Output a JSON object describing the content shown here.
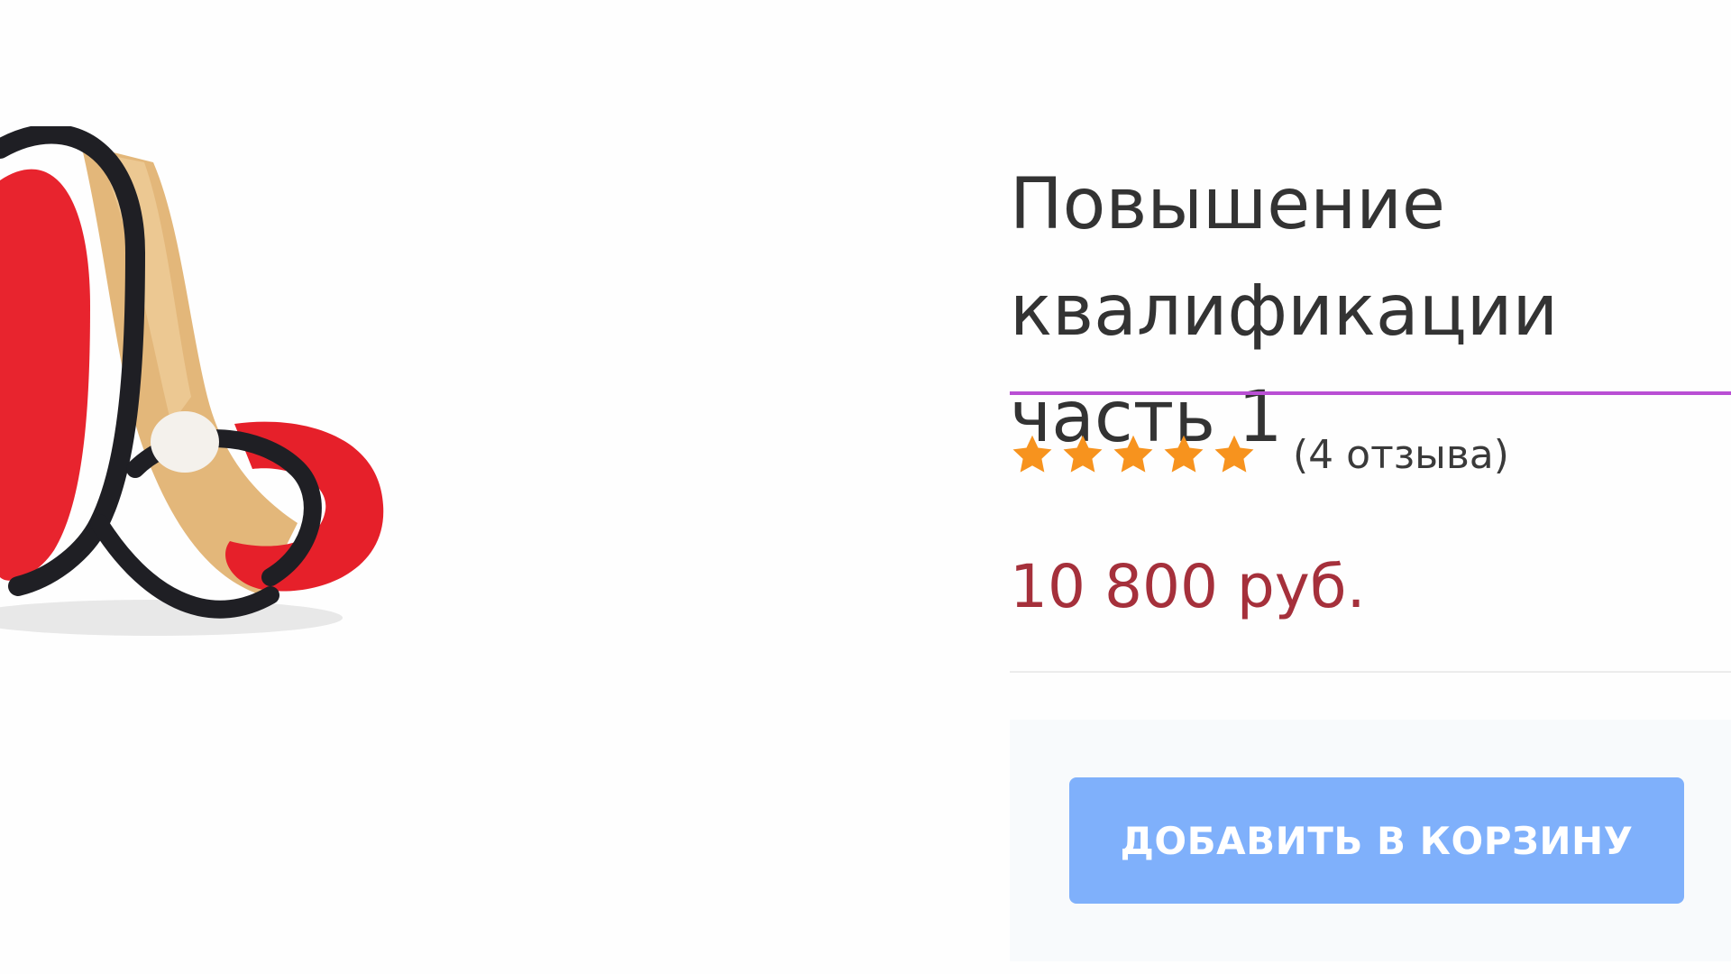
{
  "product": {
    "logo_icon": "letter-a-ribbon-logo",
    "title": "Повышение квалификации\nчасть 1",
    "rating": {
      "stars": 5,
      "max_stars": 5,
      "reviews_label": "(4 отзыва)"
    },
    "price": "10 800 руб.",
    "add_to_cart_label": "ДОБАВИТЬ В КОРЗИНУ"
  },
  "colors": {
    "divider_accent": "#b94fd4",
    "price": "#a5303b",
    "star": "#f7931e",
    "button": "#7fb0fb"
  }
}
